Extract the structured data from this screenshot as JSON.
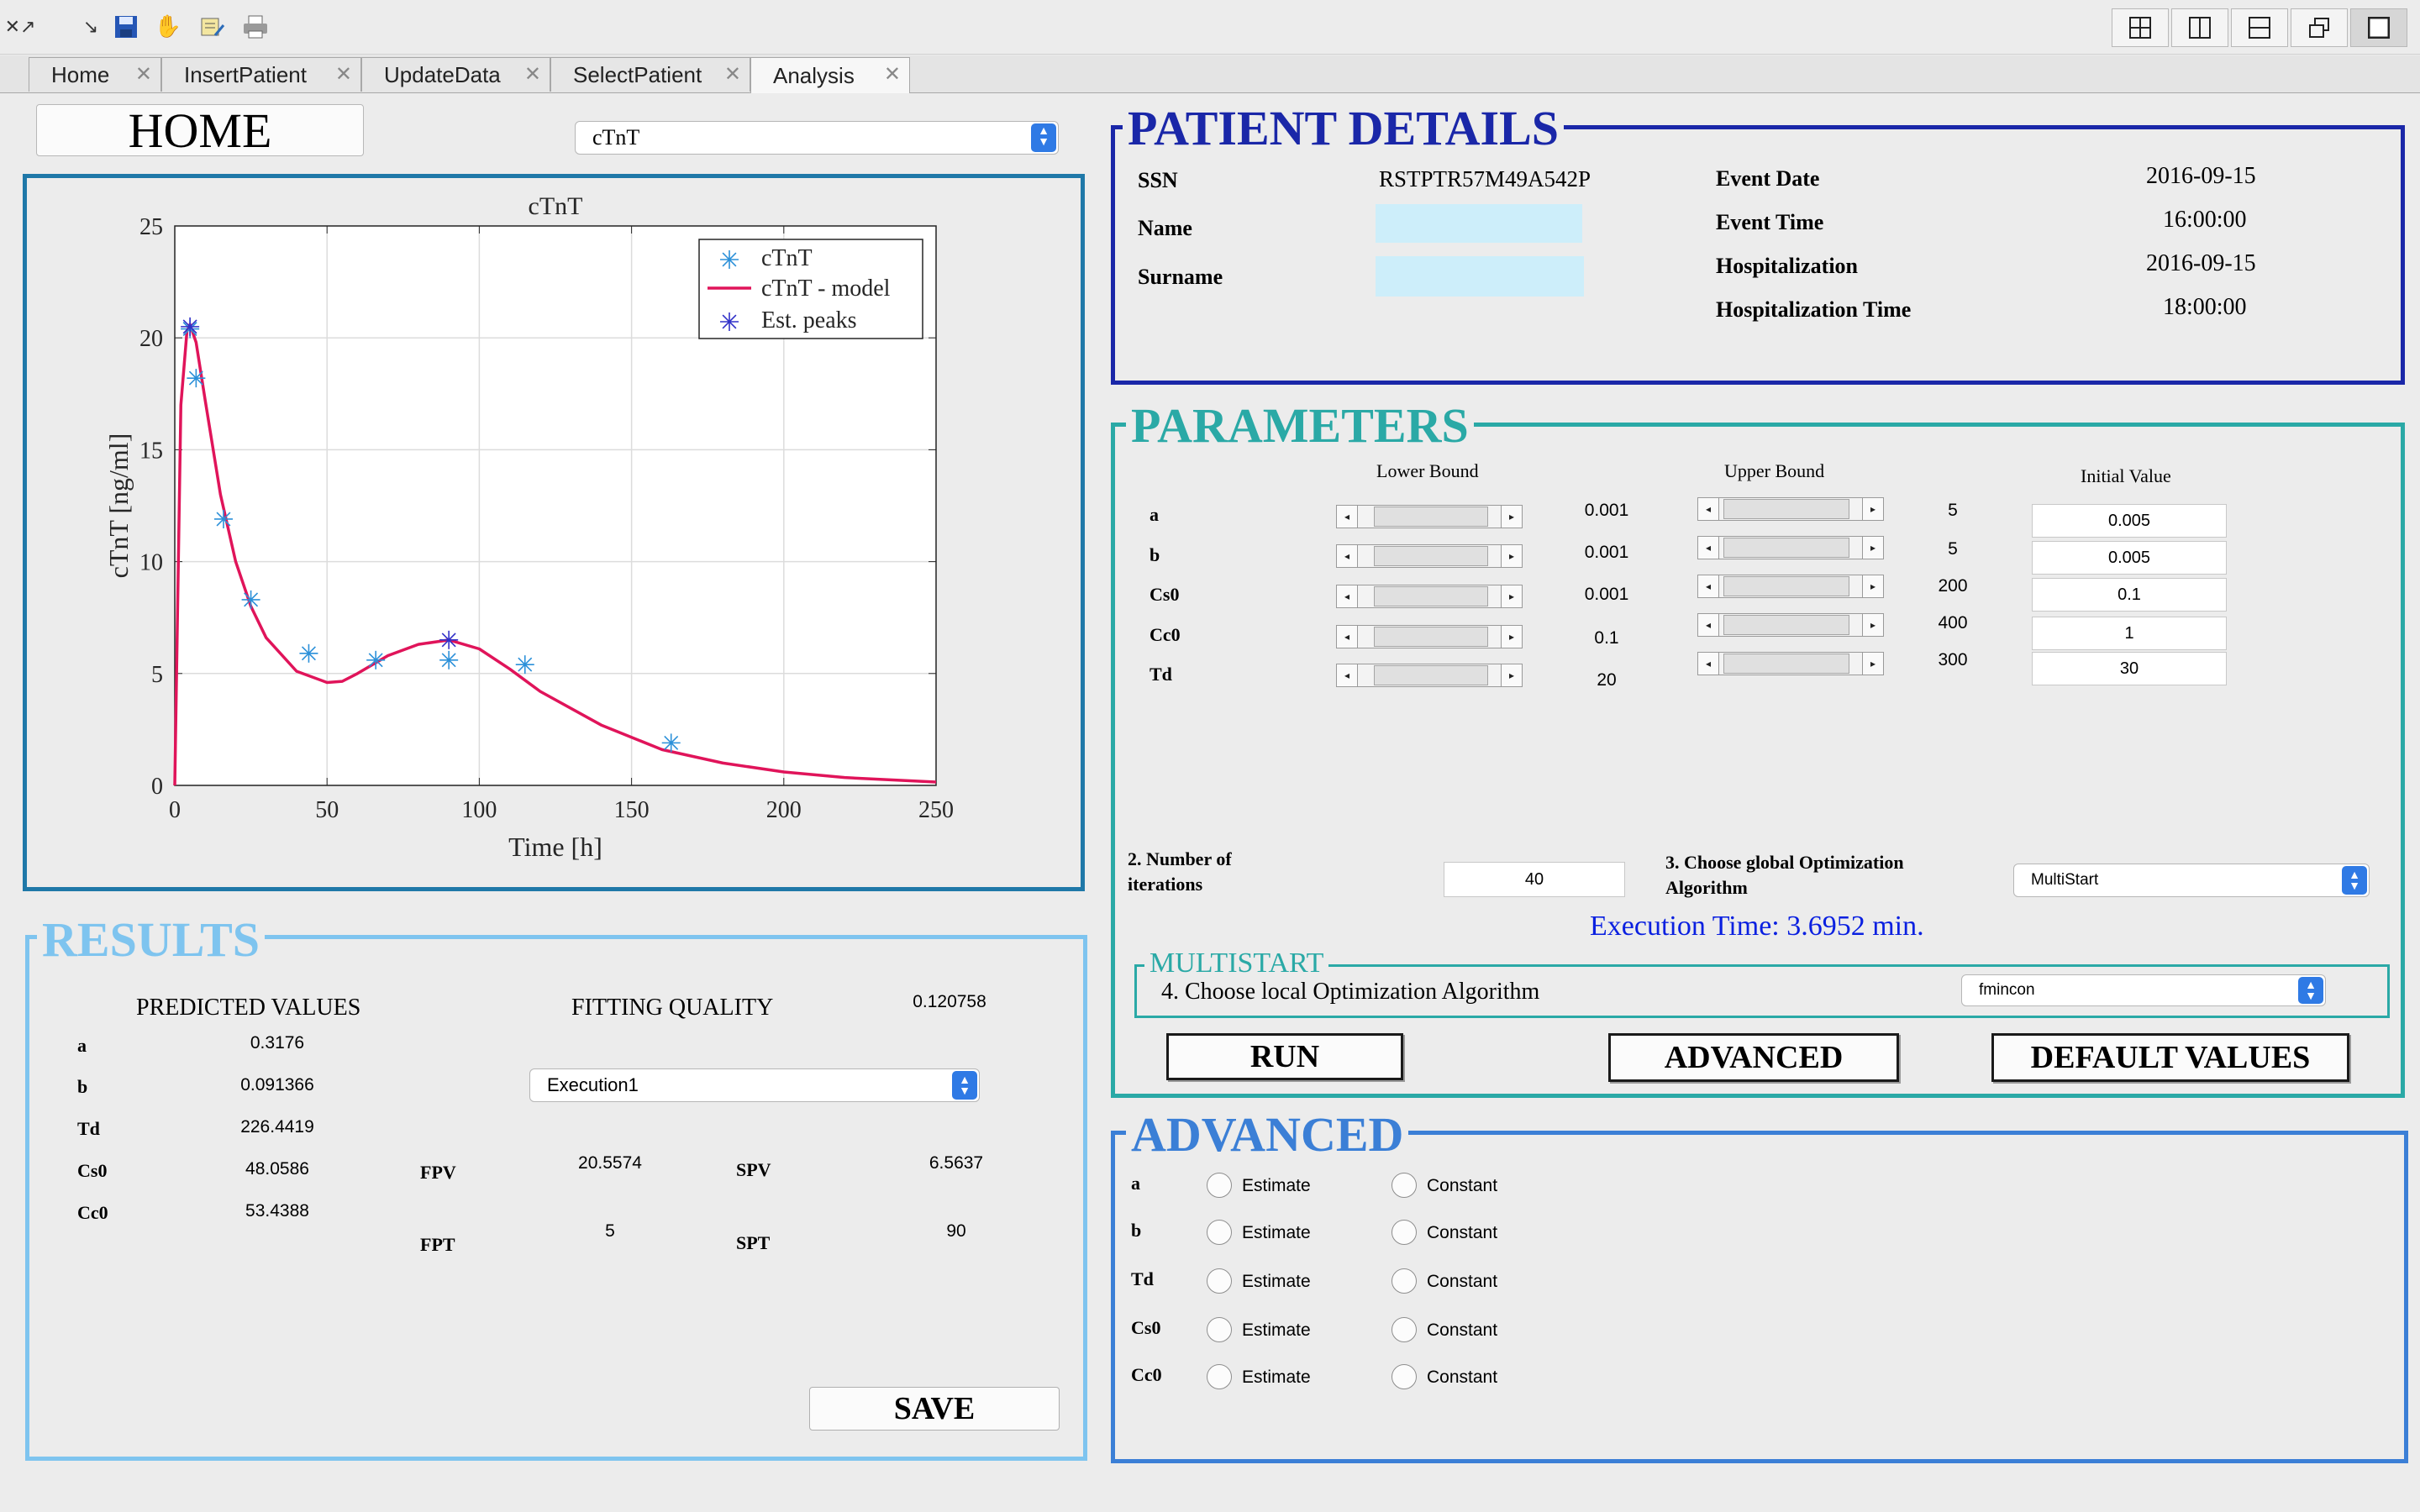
{
  "toolbar": {
    "icons": [
      "undock-icon",
      "arrow-icon",
      "save-icon",
      "pan-hand-icon",
      "edit-plot-icon",
      "print-icon"
    ],
    "layout_icons": [
      "grid-layout-icon",
      "left-right-layout-icon",
      "top-bottom-layout-icon",
      "float-layout-icon",
      "maximize-layout-icon"
    ]
  },
  "tabs": [
    {
      "label": "Home",
      "active": false
    },
    {
      "label": "InsertPatient",
      "active": false
    },
    {
      "label": "UpdateData",
      "active": false
    },
    {
      "label": "SelectPatient",
      "active": false
    },
    {
      "label": "Analysis",
      "active": true
    }
  ],
  "home_button": "HOME",
  "plot_select": {
    "value": "cTnT"
  },
  "chart_data": {
    "type": "scatter",
    "title": "cTnT",
    "xlabel": "Time [h]",
    "ylabel": "cTnT [ng/ml]",
    "xlim": [
      0,
      250
    ],
    "ylim": [
      0,
      25
    ],
    "xticks": [
      "0",
      "50",
      "100",
      "150",
      "200",
      "250"
    ],
    "yticks": [
      "0",
      "5",
      "10",
      "15",
      "20",
      "25"
    ],
    "grid": true,
    "legend_position": "top-right",
    "series": [
      {
        "name": "cTnT",
        "kind": "marker",
        "color": "#2b90d9",
        "x": [
          5,
          7,
          16,
          25,
          44,
          66,
          90,
          115,
          163
        ],
        "y": [
          20.4,
          18.2,
          11.9,
          8.3,
          5.9,
          5.6,
          5.6,
          5.4,
          1.9
        ]
      },
      {
        "name": "cTnT - model",
        "kind": "line",
        "color": "#e0145a",
        "x": [
          0,
          2,
          4,
          5,
          7,
          10,
          15,
          20,
          25,
          30,
          40,
          50,
          55,
          60,
          70,
          80,
          90,
          100,
          110,
          120,
          140,
          160,
          180,
          200,
          220,
          250
        ],
        "y": [
          0,
          17,
          20.3,
          20.6,
          19.8,
          17.2,
          13.0,
          10.0,
          8.0,
          6.6,
          5.1,
          4.6,
          4.65,
          5.0,
          5.8,
          6.3,
          6.5,
          6.1,
          5.2,
          4.2,
          2.7,
          1.6,
          1.0,
          0.6,
          0.35,
          0.15
        ]
      },
      {
        "name": "Est. peaks",
        "kind": "marker",
        "color": "#3030c8",
        "x": [
          5,
          90
        ],
        "y": [
          20.5,
          6.5
        ]
      }
    ]
  },
  "results": {
    "title": "RESULTS",
    "predicted_header": "PREDICTED VALUES",
    "fitting_header": "FITTING QUALITY",
    "fitting_value": "0.120758",
    "params": [
      {
        "label": "a",
        "value": "0.3176"
      },
      {
        "label": "b",
        "value": "0.091366"
      },
      {
        "label": "Td",
        "value": "226.4419"
      },
      {
        "label": "Cs0",
        "value": "48.0586"
      },
      {
        "label": "Cc0",
        "value": "53.4388"
      }
    ],
    "execution_select": "Execution1",
    "fpv_label": "FPV",
    "fpv_value": "20.5574",
    "spv_label": "SPV",
    "spv_value": "6.5637",
    "fpt_label": "FPT",
    "fpt_value": "5",
    "spt_label": "SPT",
    "spt_value": "90",
    "save_label": "SAVE"
  },
  "patient": {
    "title": "PATIENT DETAILS",
    "ssn_label": "SSN",
    "ssn": "RSTPTR57M49A542P",
    "name_label": "Name",
    "name": "",
    "surname_label": "Surname",
    "surname": "",
    "event_date_label": "Event Date",
    "event_date": "2016-09-15",
    "event_time_label": "Event Time",
    "event_time": "16:00:00",
    "hosp_label": "Hospitalization",
    "hosp_date": "2016-09-15",
    "hosp_time_label": "Hospitalization Time",
    "hosp_time": "18:00:00"
  },
  "parameters": {
    "title": "PARAMETERS",
    "lower_header": "Lower Bound",
    "upper_header": "Upper Bound",
    "initial_header": "Initial Value",
    "rows": [
      {
        "label": "a",
        "lower": "0.001",
        "upper": "5",
        "initial": "0.005"
      },
      {
        "label": "b",
        "lower": "0.001",
        "upper": "5",
        "initial": "0.005"
      },
      {
        "label": "Cs0",
        "lower": "0.001",
        "upper": "200",
        "initial": "0.1"
      },
      {
        "label": "Cc0",
        "lower": "0.1",
        "upper": "400",
        "initial": "1"
      },
      {
        "label": "Td",
        "lower": "20",
        "upper": "300",
        "initial": "30"
      }
    ],
    "iterations_label_1": "2. Number of",
    "iterations_label_2": "iterations",
    "iterations_value": "40",
    "global_label_1": "3. Choose global Optimization",
    "global_label_2": "Algorithm",
    "global_value": "MultiStart",
    "exec_time": "Execution Time: 3.6952 min.",
    "multistart_title": "MULTISTART",
    "local_label": "4. Choose local Optimization Algorithm",
    "local_value": "fmincon",
    "run_label": "RUN",
    "advanced_label": "ADVANCED",
    "default_label": "DEFAULT VALUES"
  },
  "advanced": {
    "title": "ADVANCED",
    "estimate_label": "Estimate",
    "constant_label": "Constant",
    "rows": [
      "a",
      "b",
      "Td",
      "Cs0",
      "Cc0"
    ]
  },
  "colors": {
    "patient_border": "#1a27a8",
    "parameters_border": "#2aa9a6",
    "results_border": "#7ec4ef",
    "advanced_border": "#3b7fd6",
    "plot_border": "#1f78a8",
    "exec_time": "#0a20e0",
    "name_field": "#cdeefa"
  }
}
